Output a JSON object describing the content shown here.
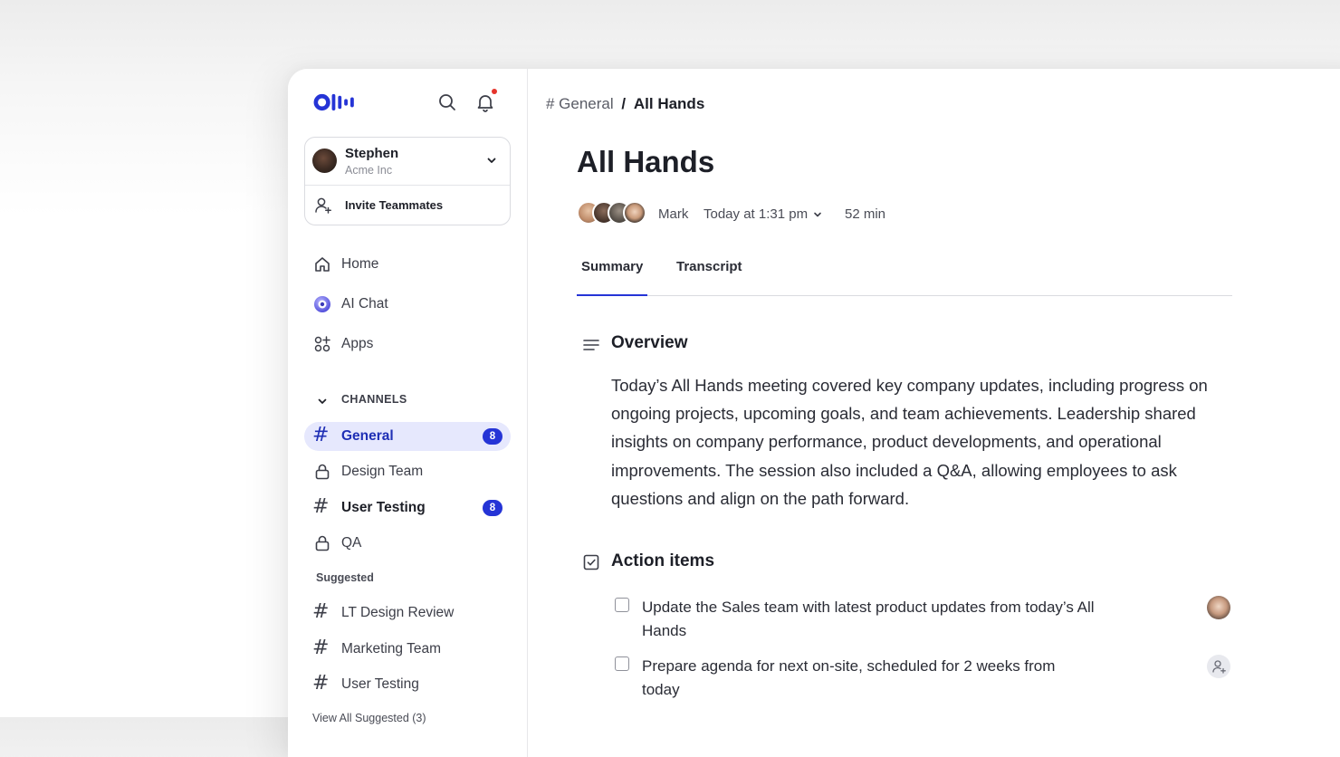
{
  "colors": {
    "accent": "#2534d6",
    "active_bg": "#e6e8fd",
    "notification_dot": "#e5342c"
  },
  "sidebar": {
    "logo_icon": "otter-logo-icon",
    "account": {
      "name": "Stephen",
      "org": "Acme Inc"
    },
    "invite_label": "Invite Teammates",
    "nav": [
      {
        "label": "Home",
        "icon": "home-icon"
      },
      {
        "label": "AI Chat",
        "icon": "ai-chat-icon"
      },
      {
        "label": "Apps",
        "icon": "apps-icon"
      }
    ],
    "channels_heading": "CHANNELS",
    "channels": [
      {
        "label": "General",
        "icon": "hash-icon",
        "badge": "8"
      },
      {
        "label": "Design Team",
        "icon": "lock-icon"
      },
      {
        "label": "User Testing",
        "icon": "hash-icon",
        "badge": "8"
      },
      {
        "label": "QA",
        "icon": "lock-icon"
      }
    ],
    "suggested_heading": "Suggested",
    "suggested": [
      {
        "label": "LT Design Review",
        "icon": "hash-icon"
      },
      {
        "label": "Marketing Team",
        "icon": "hash-icon"
      },
      {
        "label": "User Testing",
        "icon": "hash-icon"
      }
    ],
    "view_all": "View All Suggested (3)"
  },
  "main": {
    "breadcrumb": {
      "channel": "# General",
      "separator": "/",
      "current": "All Hands"
    },
    "title": "All Hands",
    "meta": {
      "owner": "Mark",
      "date": "Today at 1:31 pm",
      "duration": "52 min"
    },
    "tabs": [
      "Summary",
      "Transcript"
    ],
    "overview": {
      "title": "Overview",
      "text": "Today’s All Hands meeting covered key company updates, including progress on ongoing projects, upcoming goals, and team achievements. Leadership shared insights on company performance, product developments, and operational improvements. The session also included a Q&A, allowing employees to ask questions and align on the path forward."
    },
    "action_items": {
      "title": "Action items",
      "items": [
        {
          "text": "Update the Sales team with latest product updates from today’s All Hands",
          "assignee": "avatar"
        },
        {
          "text": "Prepare agenda for next on-site, scheduled for 2 weeks from today",
          "assignee": "assign-user-icon"
        }
      ]
    }
  }
}
